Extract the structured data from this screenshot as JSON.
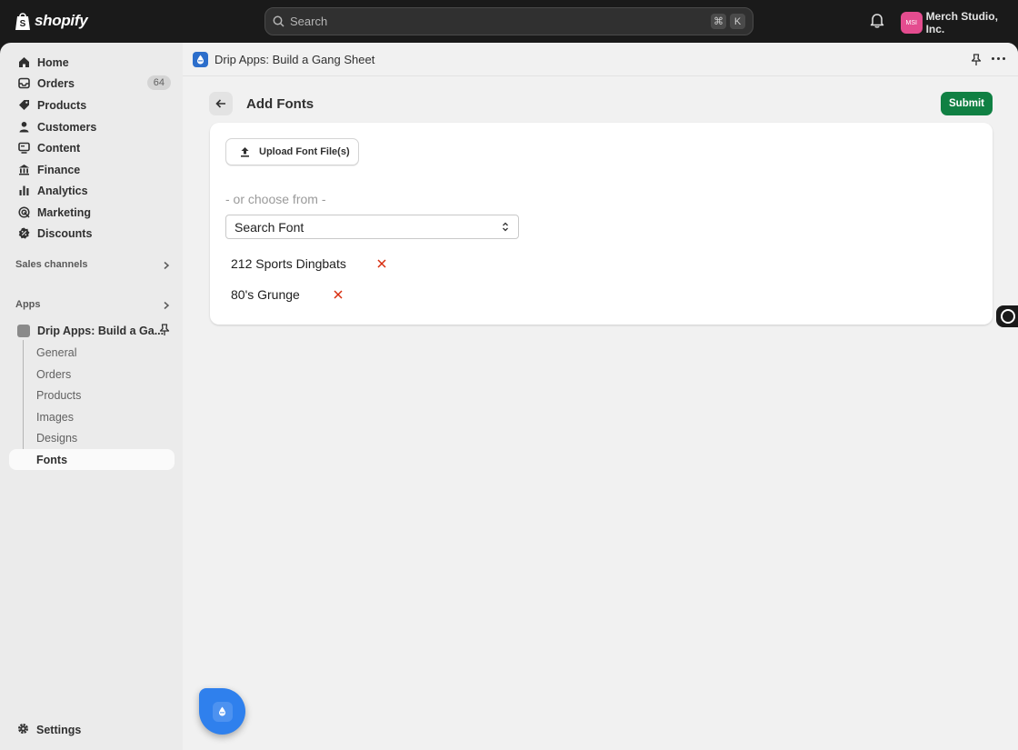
{
  "topbar": {
    "brand": "shopify",
    "search_placeholder": "Search",
    "shortcut_keys": [
      "⌘",
      "K"
    ],
    "store_initials": "MSI",
    "store_name": "Merch Studio, Inc."
  },
  "sidebar": {
    "items": [
      {
        "label": "Home",
        "icon": "home-icon"
      },
      {
        "label": "Orders",
        "icon": "inbox-icon",
        "badge": "64"
      },
      {
        "label": "Products",
        "icon": "tag-icon"
      },
      {
        "label": "Customers",
        "icon": "person-icon"
      },
      {
        "label": "Content",
        "icon": "monitor-icon"
      },
      {
        "label": "Finance",
        "icon": "bank-icon"
      },
      {
        "label": "Analytics",
        "icon": "bar-chart-icon"
      },
      {
        "label": "Marketing",
        "icon": "target-icon"
      },
      {
        "label": "Discounts",
        "icon": "discount-icon"
      }
    ],
    "sales_channels_label": "Sales channels",
    "apps_label": "Apps",
    "app_name": "Drip Apps: Build a Ga...",
    "app_subitems": [
      "General",
      "Orders",
      "Products",
      "Images",
      "Designs",
      "Fonts"
    ],
    "active_subitem": "Fonts",
    "settings_label": "Settings"
  },
  "app_header": {
    "title": "Drip Apps: Build a Gang Sheet"
  },
  "page": {
    "title": "Add Fonts",
    "submit_label": "Submit",
    "upload_label": "Upload Font File(s)",
    "or_text": "- or choose from -",
    "select_value": "Search Font",
    "fonts": [
      "212 Sports Dingbats",
      "80's Grunge"
    ]
  },
  "colors": {
    "submit_bg": "#108043",
    "remove_x": "#d82c0d",
    "app_accent": "#2c6ecb"
  }
}
